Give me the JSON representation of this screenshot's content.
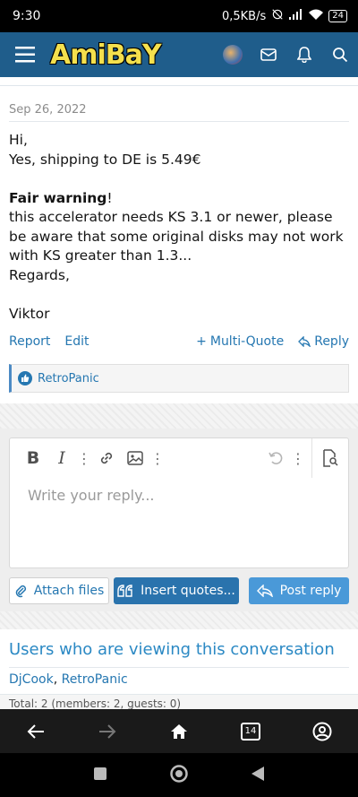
{
  "status_bar": {
    "time": "9:30",
    "network_speed": "0,5KB/s",
    "battery": "24"
  },
  "app_bar": {
    "logo_text": "AmiBaY",
    "brand_color": "#1f5d8b"
  },
  "post": {
    "date": "Sep 26, 2022",
    "lines": {
      "l1": "Hi,",
      "l2": "Yes, shipping to DE is 5.49€",
      "l3_bold": "Fair warning",
      "l3_rest": "!",
      "l4": "this accelerator needs KS 3.1 or newer, please be aware that some original disks may not work with KS greater than 1.3...",
      "l5": "Regards,",
      "l6": "Viktor"
    },
    "actions": {
      "report": "Report",
      "edit": "Edit",
      "multi_quote": "Multi-Quote",
      "reply": "Reply"
    },
    "reaction_user": "RetroPanic"
  },
  "editor": {
    "placeholder": "Write your reply...",
    "attach_label": "Attach files",
    "insert_quotes_label": "Insert quotes...",
    "post_reply_label": "Post reply"
  },
  "viewers": {
    "title": "Users who are viewing this conversation",
    "user1": "DjCook",
    "separator": ", ",
    "user2": "RetroPanic",
    "total": "Total: 2 (members: 2, guests: 0)"
  },
  "browser_bar": {
    "tab_count": "14"
  }
}
